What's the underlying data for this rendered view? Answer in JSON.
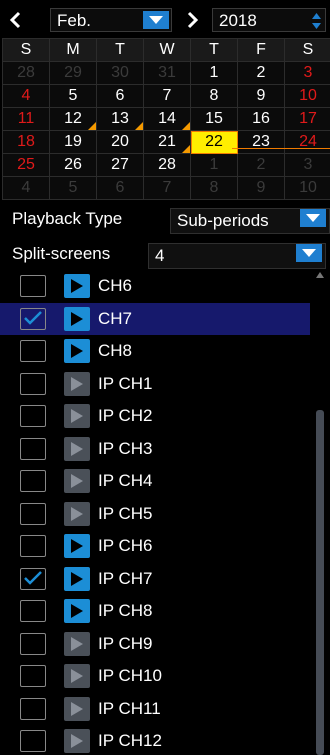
{
  "header": {
    "month": "Feb.",
    "year": "2018",
    "prev_icon": "chevron-left-icon",
    "next_icon": "chevron-right-icon"
  },
  "calendar": {
    "weekdays": [
      "S",
      "M",
      "T",
      "W",
      "T",
      "F",
      "S"
    ],
    "weeks": [
      [
        {
          "d": "28",
          "t": "dim"
        },
        {
          "d": "29",
          "t": "dim"
        },
        {
          "d": "30",
          "t": "dim"
        },
        {
          "d": "31",
          "t": "dim"
        },
        {
          "d": "1",
          "t": "wh"
        },
        {
          "d": "2",
          "t": "wh"
        },
        {
          "d": "3",
          "t": "red"
        }
      ],
      [
        {
          "d": "4",
          "t": "red"
        },
        {
          "d": "5",
          "t": "wh"
        },
        {
          "d": "6",
          "t": "wh"
        },
        {
          "d": "7",
          "t": "wh"
        },
        {
          "d": "8",
          "t": "wh"
        },
        {
          "d": "9",
          "t": "wh"
        },
        {
          "d": "10",
          "t": "red"
        }
      ],
      [
        {
          "d": "11",
          "t": "red"
        },
        {
          "d": "12",
          "t": "wh",
          "rec": true
        },
        {
          "d": "13",
          "t": "wh",
          "rec": true
        },
        {
          "d": "14",
          "t": "wh",
          "rec": true
        },
        {
          "d": "15",
          "t": "wh"
        },
        {
          "d": "16",
          "t": "wh"
        },
        {
          "d": "17",
          "t": "red"
        }
      ],
      [
        {
          "d": "18",
          "t": "red"
        },
        {
          "d": "19",
          "t": "wh"
        },
        {
          "d": "20",
          "t": "wh"
        },
        {
          "d": "21",
          "t": "wh",
          "rec": true
        },
        {
          "d": "22",
          "t": "sel"
        },
        {
          "d": "23",
          "t": "wh"
        },
        {
          "d": "24",
          "t": "red"
        }
      ],
      [
        {
          "d": "25",
          "t": "red"
        },
        {
          "d": "26",
          "t": "wh"
        },
        {
          "d": "27",
          "t": "wh"
        },
        {
          "d": "28",
          "t": "wh"
        },
        {
          "d": "1",
          "t": "dim"
        },
        {
          "d": "2",
          "t": "dim"
        },
        {
          "d": "3",
          "t": "dim"
        }
      ],
      [
        {
          "d": "4",
          "t": "dim"
        },
        {
          "d": "5",
          "t": "dim"
        },
        {
          "d": "6",
          "t": "dim"
        },
        {
          "d": "7",
          "t": "dim"
        },
        {
          "d": "8",
          "t": "dim"
        },
        {
          "d": "9",
          "t": "dim"
        },
        {
          "d": "10",
          "t": "dim"
        }
      ]
    ],
    "colors": {
      "weekend": "#e01a1a",
      "selected": "#ffee00",
      "record_marker": "#f59a00"
    }
  },
  "playback": {
    "label": "Playback Type",
    "value": "Sub-periods"
  },
  "split": {
    "label": "Split-screens",
    "value": "4"
  },
  "channels": [
    {
      "label": "CH6",
      "checked": false,
      "active": true,
      "selected": false
    },
    {
      "label": "CH7",
      "checked": true,
      "active": true,
      "selected": true
    },
    {
      "label": "CH8",
      "checked": false,
      "active": true,
      "selected": false
    },
    {
      "label": "IP CH1",
      "checked": false,
      "active": false,
      "selected": false
    },
    {
      "label": "IP CH2",
      "checked": false,
      "active": false,
      "selected": false
    },
    {
      "label": "IP CH3",
      "checked": false,
      "active": false,
      "selected": false
    },
    {
      "label": "IP CH4",
      "checked": false,
      "active": false,
      "selected": false
    },
    {
      "label": "IP CH5",
      "checked": false,
      "active": false,
      "selected": false
    },
    {
      "label": "IP CH6",
      "checked": false,
      "active": true,
      "selected": false
    },
    {
      "label": "IP CH7",
      "checked": true,
      "active": true,
      "selected": false
    },
    {
      "label": "IP CH8",
      "checked": false,
      "active": true,
      "selected": false
    },
    {
      "label": "IP CH9",
      "checked": false,
      "active": false,
      "selected": false
    },
    {
      "label": "IP CH10",
      "checked": false,
      "active": false,
      "selected": false
    },
    {
      "label": "IP CH11",
      "checked": false,
      "active": false,
      "selected": false
    },
    {
      "label": "IP CH12",
      "checked": false,
      "active": false,
      "selected": false
    }
  ],
  "colors": {
    "accent": "#1f7fd0",
    "selected_row": "#16196c",
    "play_active": "#1c8ed6",
    "play_inactive": "#4a5058"
  }
}
